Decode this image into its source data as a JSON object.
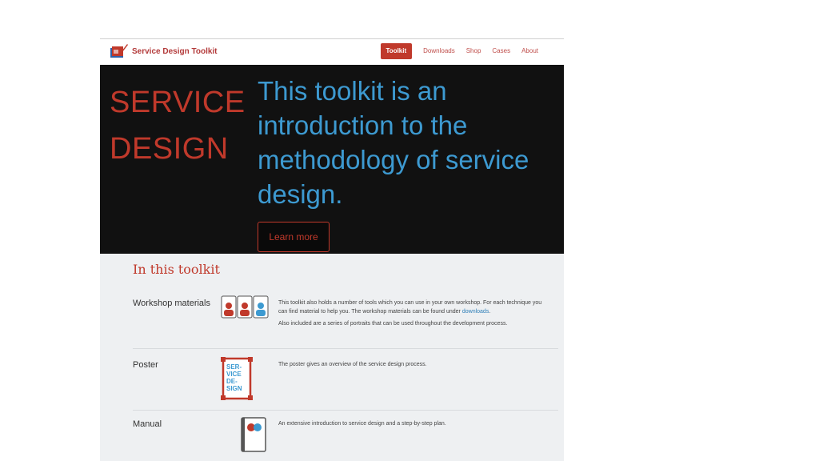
{
  "header": {
    "brand": "Service Design Toolkit",
    "nav": [
      "Toolkit",
      "Downloads",
      "Shop",
      "Cases",
      "About"
    ],
    "active_index": 0
  },
  "hero": {
    "title_line1": "SERVICE",
    "title_line2": "DESIGN",
    "headline": "This toolkit is an introduction to the methodology of service design.",
    "cta": "Learn more"
  },
  "toolkit": {
    "heading": "In this toolkit",
    "items": [
      {
        "label": "Workshop materials",
        "desc1": "This toolkit also holds a number of tools which you can use in your own workshop. For each technique you can find material to help you. The workshop materials can be found under",
        "link": "downloads",
        "desc2": "Also included are a series of portraits that can be used throughout the development process."
      },
      {
        "label": "Poster",
        "desc1": "The poster gives an overview of the service design process.",
        "poster_text": [
          "SER-",
          "VICE",
          "DE-",
          "SIGN"
        ]
      },
      {
        "label": "Manual",
        "desc1": "An extensive introduction to service design and a step-by-step plan."
      }
    ]
  },
  "colors": {
    "accent": "#c0392b",
    "blue": "#3d9ad1",
    "hero_bg": "#111111",
    "content_bg": "#eef0f2"
  }
}
